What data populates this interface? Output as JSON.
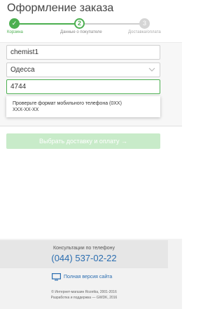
{
  "header": {
    "title": "Оформление заказа",
    "steps": [
      {
        "number": "✓",
        "label": "Корзина",
        "state": "done"
      },
      {
        "number": "2",
        "label": "Данные о покупателе",
        "state": "active"
      },
      {
        "number": "3",
        "label": "Доставка/оплата",
        "state": "upcoming"
      }
    ]
  },
  "form": {
    "login_value": "chemist1",
    "city_value": "Одесса",
    "phone_value": "4744",
    "error_line1": "Проверьте формат мобильного телефона (0XX)",
    "error_line2": "XXX-XX-XX",
    "submit_label": "Выбрать доставку и оплату →"
  },
  "footer": {
    "consult_label": "Консультации по телефону",
    "phone": "(044) 537-02-22",
    "full_version": "Полная версия сайта",
    "copyright": "© Интернет-магазин Rozetka, 2001-2016",
    "developer": "Разработка и поддержка — GWDK, 2016"
  },
  "colors": {
    "accent": "#4caf50",
    "link": "#2a6db0",
    "submit_disabled": "#c8ebc9"
  }
}
